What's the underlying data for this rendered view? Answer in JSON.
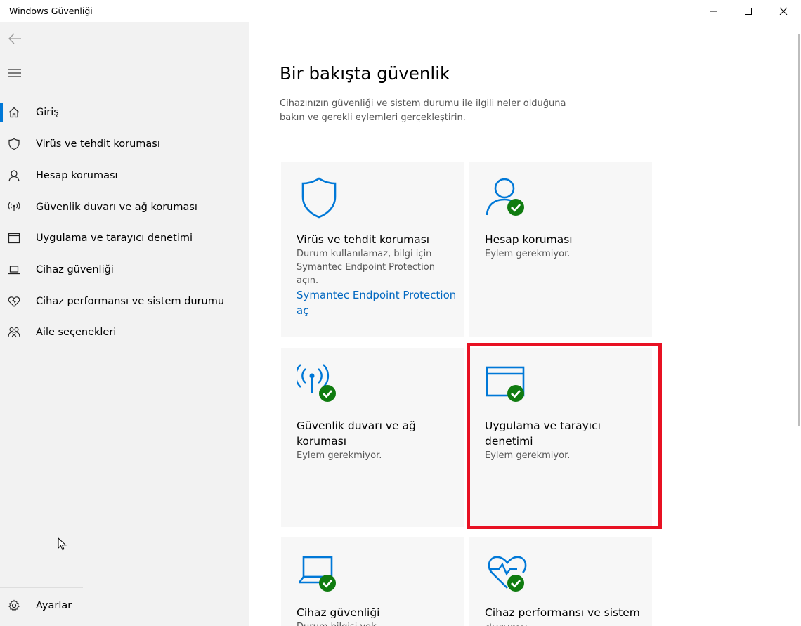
{
  "window": {
    "title": "Windows Güvenliği"
  },
  "sidebar": {
    "items": [
      {
        "label": "Giriş",
        "icon": "home-icon"
      },
      {
        "label": "Virüs ve tehdit koruması",
        "icon": "shield-icon"
      },
      {
        "label": "Hesap koruması",
        "icon": "person-icon"
      },
      {
        "label": "Güvenlik duvarı ve ağ koruması",
        "icon": "antenna-icon"
      },
      {
        "label": "Uygulama ve tarayıcı denetimi",
        "icon": "browser-window-icon"
      },
      {
        "label": "Cihaz güvenliği",
        "icon": "laptop-icon"
      },
      {
        "label": "Cihaz performansı ve sistem durumu",
        "icon": "heart-pulse-icon"
      },
      {
        "label": "Aile seçenekleri",
        "icon": "family-icon"
      }
    ],
    "settings_label": "Ayarlar"
  },
  "main": {
    "title": "Bir bakışta güvenlik",
    "description": "Cihazınızın güvenliği ve sistem durumu ile ilgili neler olduğuna bakın ve gerekli eylemleri gerçekleştirin.",
    "tiles": [
      {
        "title": "Virüs ve tehdit koruması",
        "status": "Durum kullanılamaz, bilgi için Symantec Endpoint Protection açın.",
        "link": "Symantec Endpoint Protection aç"
      },
      {
        "title": "Hesap koruması",
        "status": "Eylem gerekmiyor."
      },
      {
        "title": "Güvenlik duvarı ve ağ koruması",
        "status": "Eylem gerekmiyor."
      },
      {
        "title": "Uygulama ve tarayıcı denetimi",
        "status": "Eylem gerekmiyor."
      },
      {
        "title": "Cihaz güvenliği",
        "status": "Durum bilgisi yok."
      },
      {
        "title": "Cihaz performansı ve sistem durumu",
        "status": ""
      }
    ]
  },
  "colors": {
    "accent": "#0078d7",
    "ok_green": "#107c10",
    "highlight_red": "#e81123",
    "link": "#0067c0"
  }
}
